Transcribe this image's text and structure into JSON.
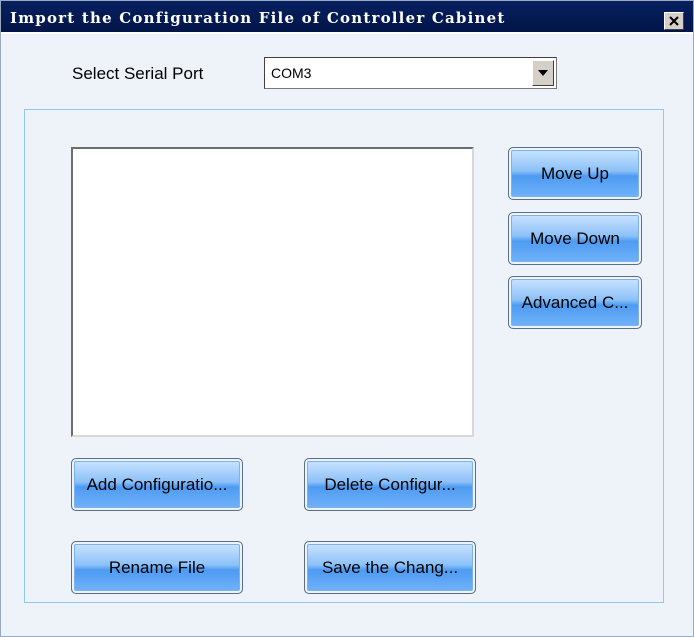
{
  "window": {
    "title": "Import the Configuration File of Controller Cabinet",
    "close_icon": "close-icon"
  },
  "serial_port": {
    "label": "Select Serial Port",
    "selected": "COM3"
  },
  "side_buttons": {
    "move_up": "Move Up",
    "move_down": "Move Down",
    "advanced": "Advanced C..."
  },
  "bottom_buttons": {
    "add": "Add Configuratio...",
    "delete": "Delete Configur...",
    "rename": "Rename File",
    "save": "Save the Chang..."
  },
  "colors": {
    "title_bar": "#06205f",
    "button_blue": "#4d9bf2",
    "group_border": "#8fc7f0"
  }
}
